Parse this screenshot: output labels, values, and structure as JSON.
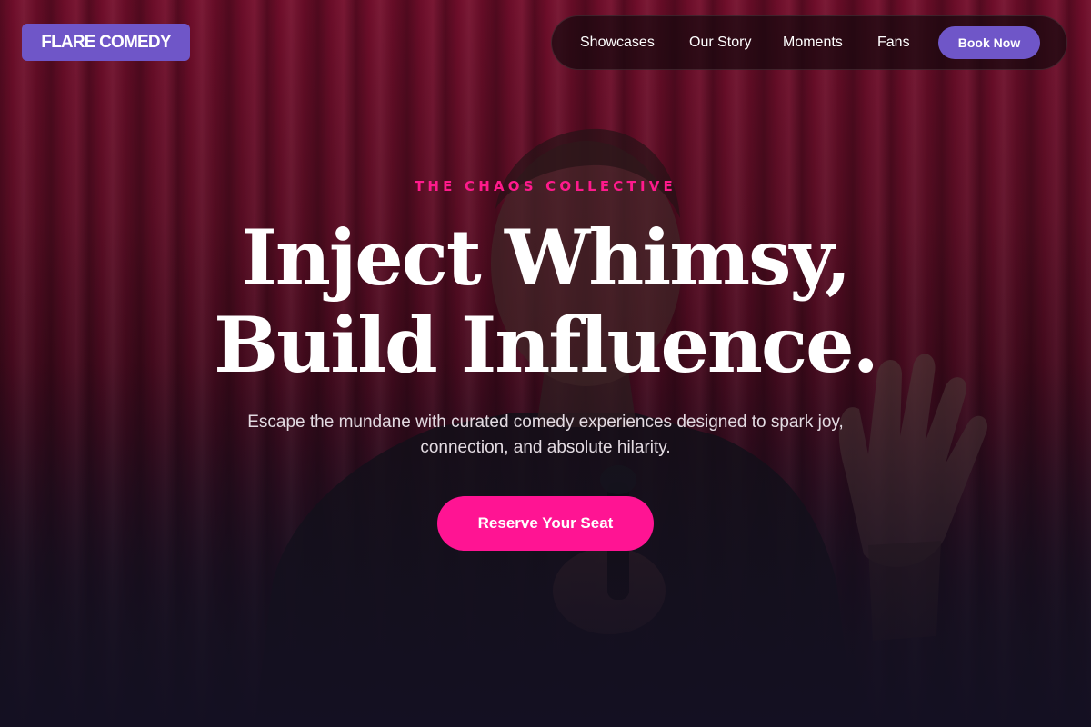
{
  "brand": {
    "logo_text": "FLARE COMEDY",
    "accent": "#6f56c8",
    "highlight": "#ff1493"
  },
  "nav": {
    "items": [
      {
        "label": "Showcases"
      },
      {
        "label": "Our Story"
      },
      {
        "label": "Moments"
      },
      {
        "label": "Fans"
      }
    ],
    "cta_label": "Book Now"
  },
  "hero": {
    "eyebrow": "THE CHAOS COLLECTIVE",
    "headline_line1": "Inject Whimsy,",
    "headline_line2": "Build Influence.",
    "subtext": "Escape the mundane with curated comedy experiences designed to spark joy, connection, and absolute hilarity.",
    "cta_label": "Reserve Your Seat",
    "background_image": "comedian-on-stage-with-red-curtain"
  }
}
